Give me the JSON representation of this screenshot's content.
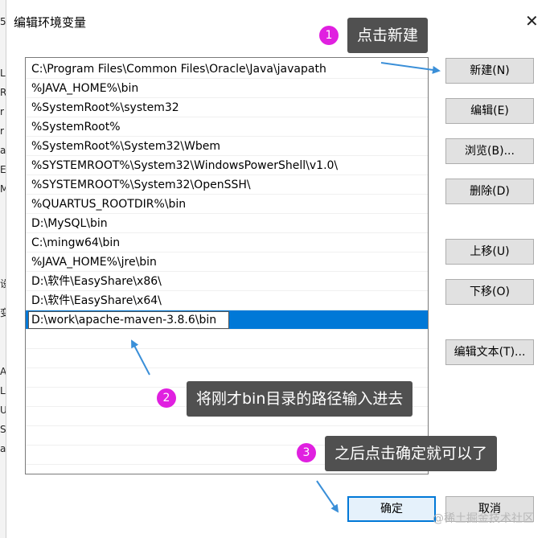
{
  "dialog": {
    "title": "编辑环境变量",
    "close_glyph": "✕"
  },
  "background_window": {
    "fragments": [
      "5",
      "L",
      "R",
      "r",
      "r",
      "a",
      "E",
      "M",
      "设",
      "变",
      "A",
      "L",
      "U",
      "S",
      "a",
      "A",
      "A",
      "系"
    ]
  },
  "path_list": {
    "items": [
      "C:\\Program Files\\Common Files\\Oracle\\Java\\javapath",
      "%JAVA_HOME%\\bin",
      "%SystemRoot%\\system32",
      "%SystemRoot%",
      "%SystemRoot%\\System32\\Wbem",
      "%SYSTEMROOT%\\System32\\WindowsPowerShell\\v1.0\\",
      "%SYSTEMROOT%\\System32\\OpenSSH\\",
      "%QUARTUS_ROOTDIR%\\bin",
      "D:\\MySQL\\bin",
      "C:\\mingw64\\bin",
      "%JAVA_HOME%\\jre\\bin",
      "D:\\软件\\EasyShare\\x86\\",
      "D:\\软件\\EasyShare\\x64\\"
    ],
    "editing_value": "D:\\work\\apache-maven-3.8.6\\bin"
  },
  "buttons": {
    "new": "新建(N)",
    "edit": "编辑(E)",
    "browse": "浏览(B)...",
    "delete": "删除(D)",
    "move_up": "上移(U)",
    "move_down": "下移(O)",
    "edit_text": "编辑文本(T)...",
    "ok": "确定",
    "cancel": "取消"
  },
  "annotations": [
    {
      "number": "1",
      "text": "点击新建"
    },
    {
      "number": "2",
      "text": "将刚才bin目录的路径输入进去"
    },
    {
      "number": "3",
      "text": "之后点击确定就可以了"
    }
  ],
  "watermark": "@稀土掘金技术社区",
  "colors": {
    "selection": "#0078d7",
    "badge": "#e020e0",
    "callout_bg": "#505050",
    "arrow": "#3a8fd8"
  }
}
